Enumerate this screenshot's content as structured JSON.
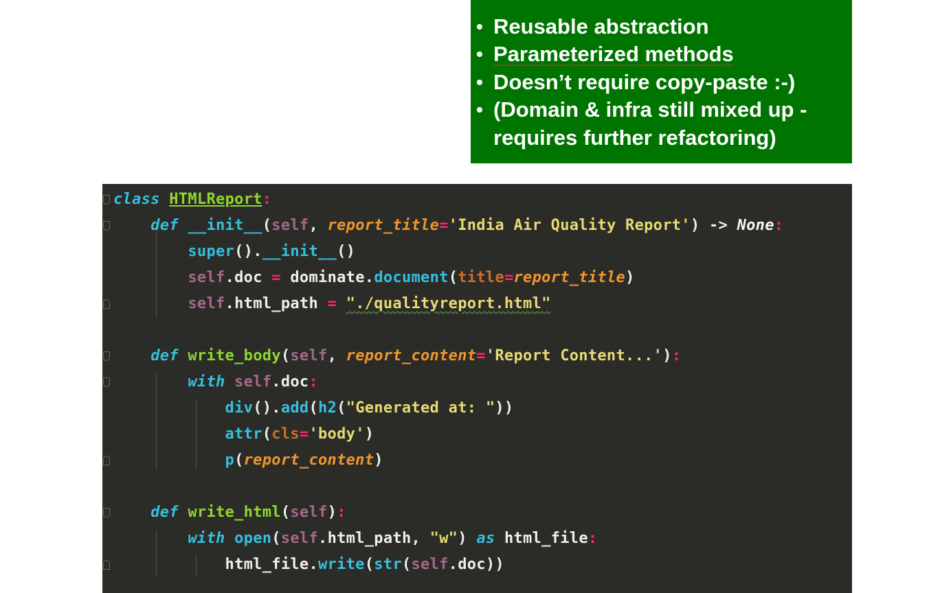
{
  "callout": {
    "bullets": [
      "Reusable abstraction",
      "Parameterized methods",
      "Doesn’t require copy-paste :-)",
      "(Domain & infra still mixed up -",
      "requires further refactoring)"
    ],
    "background": "#007400"
  },
  "code": {
    "class_kw": "class",
    "class_name": "HTMLReport",
    "colon": ":",
    "def": "def",
    "init_name": "__init__",
    "self": "self",
    "report_title_param": "report_title",
    "report_title_default": "'India Air Quality Report'",
    "arrow": "->",
    "none": "None",
    "super": "super",
    "doc_attr": "doc",
    "dominate": "dominate",
    "document": "document",
    "title_kw": "title",
    "html_path_attr": "html_path",
    "html_path_value": "\"./qualityreport.html\"",
    "write_body": "write_body",
    "report_content_param": "report_content",
    "report_content_default": "'Report Content...'",
    "with": "with",
    "div": "div",
    "add": "add",
    "h2": "h2",
    "generated_at": "\"Generated at: \"",
    "attr": "attr",
    "cls_kw": "cls",
    "body_str": "'body'",
    "p": "p",
    "write_html": "write_html",
    "open": "open",
    "w_str": "\"w\"",
    "as": "as",
    "html_file": "html_file",
    "write": "write",
    "str": "str"
  },
  "colors": {
    "editor_bg": "#2b2b27",
    "keyword": "#35c0e0",
    "function": "#8fd630",
    "self": "#a6688a",
    "param": "#f0962d",
    "string": "#e6db74",
    "operator": "#f92672"
  },
  "icons": [
    "fold-marker-icon"
  ]
}
